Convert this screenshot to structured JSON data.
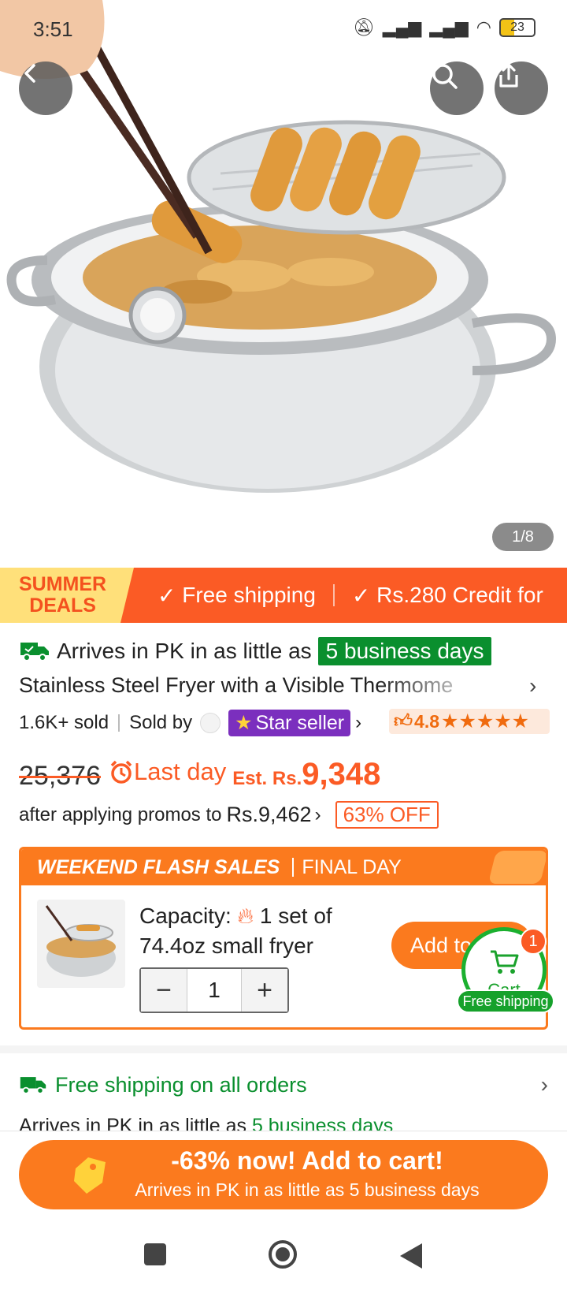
{
  "status": {
    "time": "3:51",
    "battery": "23"
  },
  "gallery": {
    "counter": "1/8"
  },
  "promo_banner": {
    "summer_line1": "SUMMER",
    "summer_line2": "DEALS",
    "items": [
      "Free shipping",
      "Rs.280 Credit for"
    ]
  },
  "delivery": {
    "prefix": "Arrives in PK in as little as",
    "days_badge": "5 business days"
  },
  "product": {
    "title": "Stainless Steel Fryer with a Visible Thermome",
    "sold": "1.6K+ sold",
    "sold_by": "Sold by",
    "star_seller": "Star seller",
    "rating": "4.8"
  },
  "price": {
    "original": "25,376",
    "last_day": "Last day",
    "est_label": "Est. Rs.",
    "est_price": "9,348",
    "promo_text": "after applying promos to",
    "promo_price": "Rs.9,462",
    "off_badge": "63% OFF"
  },
  "flash_sale": {
    "title": "WEEKEND FLASH SALES",
    "subtitle": "FINAL DAY",
    "capacity_label": "Capacity:",
    "capacity_line1": "1 set of",
    "capacity_line2": "74.4oz small fryer",
    "quantity": "1",
    "add_button": "Add to"
  },
  "floating_cart": {
    "count": "1",
    "label": "Cart",
    "badge": "Free shipping"
  },
  "shipping": {
    "title": "Free shipping on all orders",
    "sub_prefix": "Arrives in PK in as little as",
    "sub_days": "5 business days"
  },
  "cta": {
    "main": "-63% now! Add to cart!",
    "sub": "Arrives in PK in as little as 5 business days"
  },
  "colors": {
    "accent": "#fb5b25",
    "cta": "#fb7a1e",
    "green": "#0a8f2e",
    "star_seller": "#7b2fbe"
  }
}
